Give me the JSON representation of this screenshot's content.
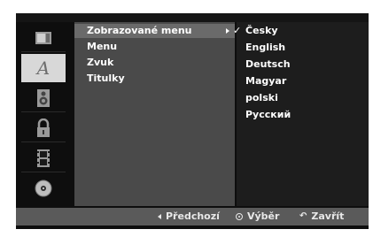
{
  "icons": [
    {
      "name": "disc-settings-icon"
    },
    {
      "name": "language-icon",
      "glyph": "A"
    },
    {
      "name": "speaker-icon"
    },
    {
      "name": "lock-icon"
    },
    {
      "name": "film-icon"
    },
    {
      "name": "disc-icon"
    }
  ],
  "menu": {
    "items": [
      {
        "label": "Zobrazované menu",
        "selected": true
      },
      {
        "label": "Menu"
      },
      {
        "label": "Zvuk"
      },
      {
        "label": "Titulky"
      }
    ]
  },
  "options": {
    "items": [
      {
        "label": "Česky",
        "checked": true
      },
      {
        "label": "English"
      },
      {
        "label": "Deutsch"
      },
      {
        "label": "Magyar"
      },
      {
        "label": "polski"
      },
      {
        "label": "Русский"
      }
    ]
  },
  "footer": {
    "prev_label": "Předchozí",
    "select_label": "Výběr",
    "close_label": "Zavřít"
  }
}
